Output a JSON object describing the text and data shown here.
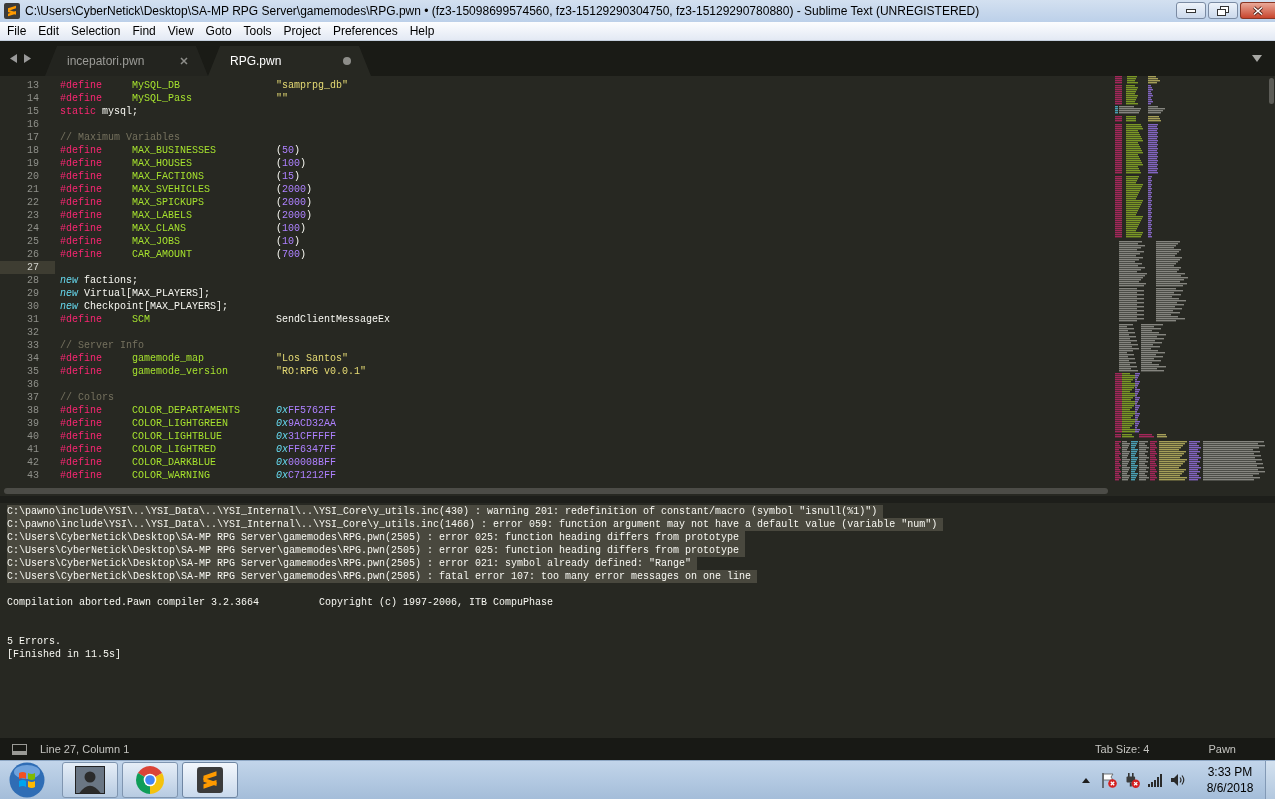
{
  "window": {
    "title": "C:\\Users\\CyberNetick\\Desktop\\SA-MP RPG Server\\gamemodes\\RPG.pwn • (fz3-15098699574560, fz3-15129290304750, fz3-15129290780880) - Sublime Text (UNREGISTERED)"
  },
  "menu": [
    "File",
    "Edit",
    "Selection",
    "Find",
    "View",
    "Goto",
    "Tools",
    "Project",
    "Preferences",
    "Help"
  ],
  "tabs": [
    {
      "label": "incepatori.pwn",
      "selected": false,
      "modified": false
    },
    {
      "label": "RPG.pwn",
      "selected": true,
      "modified": true
    }
  ],
  "editor": {
    "lines": [
      {
        "number": "13",
        "current": false,
        "kind": "define",
        "keyword": "#define",
        "name": "MySQL_DB",
        "value": [
          {
            "kind": "string",
            "text": "\"samprpg_db\""
          }
        ]
      },
      {
        "number": "14",
        "current": false,
        "kind": "define",
        "keyword": "#define",
        "name": "MySQL_Pass",
        "value": [
          {
            "kind": "string",
            "text": "\"\""
          }
        ]
      },
      {
        "number": "15",
        "current": false,
        "kind": "statement",
        "words": [
          {
            "kind": "keyword",
            "text": "static"
          },
          {
            "kind": "plain",
            "text": "mysql;"
          }
        ]
      },
      {
        "number": "16",
        "current": false,
        "kind": "blank"
      },
      {
        "number": "17",
        "current": false,
        "kind": "comment",
        "text": "// Maximum Variables"
      },
      {
        "number": "18",
        "current": false,
        "kind": "define",
        "keyword": "#define",
        "name": "MAX_BUSINESSES",
        "value": [
          {
            "kind": "plain",
            "text": "("
          },
          {
            "kind": "number",
            "text": "50"
          },
          {
            "kind": "plain",
            "text": ")"
          }
        ]
      },
      {
        "number": "19",
        "current": false,
        "kind": "define",
        "keyword": "#define",
        "name": "MAX_HOUSES",
        "value": [
          {
            "kind": "plain",
            "text": "("
          },
          {
            "kind": "number",
            "text": "100"
          },
          {
            "kind": "plain",
            "text": ")"
          }
        ]
      },
      {
        "number": "20",
        "current": false,
        "kind": "define",
        "keyword": "#define",
        "name": "MAX_FACTIONS",
        "value": [
          {
            "kind": "plain",
            "text": "("
          },
          {
            "kind": "number",
            "text": "15"
          },
          {
            "kind": "plain",
            "text": ")"
          }
        ]
      },
      {
        "number": "21",
        "current": false,
        "kind": "define",
        "keyword": "#define",
        "name": "MAX_SVEHICLES",
        "value": [
          {
            "kind": "plain",
            "text": "("
          },
          {
            "kind": "number",
            "text": "2000"
          },
          {
            "kind": "plain",
            "text": ")"
          }
        ]
      },
      {
        "number": "22",
        "current": false,
        "kind": "define",
        "keyword": "#define",
        "name": "MAX_SPICKUPS",
        "value": [
          {
            "kind": "plain",
            "text": "("
          },
          {
            "kind": "number",
            "text": "2000"
          },
          {
            "kind": "plain",
            "text": ")"
          }
        ]
      },
      {
        "number": "23",
        "current": false,
        "kind": "define",
        "keyword": "#define",
        "name": "MAX_LABELS",
        "value": [
          {
            "kind": "plain",
            "text": "("
          },
          {
            "kind": "number",
            "text": "2000"
          },
          {
            "kind": "plain",
            "text": ")"
          }
        ]
      },
      {
        "number": "24",
        "current": false,
        "kind": "define",
        "keyword": "#define",
        "name": "MAX_CLANS",
        "value": [
          {
            "kind": "plain",
            "text": "("
          },
          {
            "kind": "number",
            "text": "100"
          },
          {
            "kind": "plain",
            "text": ")"
          }
        ]
      },
      {
        "number": "25",
        "current": false,
        "kind": "define",
        "keyword": "#define",
        "name": "MAX_JOBS",
        "value": [
          {
            "kind": "plain",
            "text": "("
          },
          {
            "kind": "number",
            "text": "10"
          },
          {
            "kind": "plain",
            "text": ")"
          }
        ]
      },
      {
        "number": "26",
        "current": false,
        "kind": "define",
        "keyword": "#define",
        "name": "CAR_AMOUNT",
        "value": [
          {
            "kind": "plain",
            "text": "("
          },
          {
            "kind": "number",
            "text": "700"
          },
          {
            "kind": "plain",
            "text": ")"
          }
        ]
      },
      {
        "number": "27",
        "current": true,
        "kind": "blank"
      },
      {
        "number": "28",
        "current": false,
        "kind": "statement",
        "words": [
          {
            "kind": "storage",
            "text": "new"
          },
          {
            "kind": "plain",
            "text": "factions;"
          }
        ]
      },
      {
        "number": "29",
        "current": false,
        "kind": "statement",
        "words": [
          {
            "kind": "storage",
            "text": "new"
          },
          {
            "kind": "plain",
            "text": "Virtual[MAX_PLAYERS];"
          }
        ]
      },
      {
        "number": "30",
        "current": false,
        "kind": "statement",
        "words": [
          {
            "kind": "storage",
            "text": "new"
          },
          {
            "kind": "plain",
            "text": "Checkpoint[MAX_PLAYERS];"
          }
        ]
      },
      {
        "number": "31",
        "current": false,
        "kind": "define",
        "keyword": "#define",
        "name": "SCM",
        "value": [
          {
            "kind": "plain",
            "text": "SendClientMessageEx"
          }
        ]
      },
      {
        "number": "32",
        "current": false,
        "kind": "blank"
      },
      {
        "number": "33",
        "current": false,
        "kind": "comment",
        "text": "// Server Info"
      },
      {
        "number": "34",
        "current": false,
        "kind": "define",
        "keyword": "#define",
        "name": "gamemode_map",
        "value": [
          {
            "kind": "string",
            "text": "\"Los Santos\""
          }
        ]
      },
      {
        "number": "35",
        "current": false,
        "kind": "define",
        "keyword": "#define",
        "name": "gamemode_version",
        "value": [
          {
            "kind": "string",
            "text": "\"RO:RPG v0.0.1\""
          }
        ]
      },
      {
        "number": "36",
        "current": false,
        "kind": "blank"
      },
      {
        "number": "37",
        "current": false,
        "kind": "comment",
        "text": "// Colors"
      },
      {
        "number": "38",
        "current": false,
        "kind": "define",
        "keyword": "#define",
        "name": "COLOR_DEPARTAMENTS",
        "value": [
          {
            "kind": "hex-prefix",
            "text": "0x"
          },
          {
            "kind": "number",
            "text": "FF5762FF"
          }
        ]
      },
      {
        "number": "39",
        "current": false,
        "kind": "define",
        "keyword": "#define",
        "name": "COLOR_LIGHTGREEN",
        "value": [
          {
            "kind": "hex-prefix",
            "text": "0x"
          },
          {
            "kind": "number",
            "text": "9ACD32AA"
          }
        ]
      },
      {
        "number": "40",
        "current": false,
        "kind": "define",
        "keyword": "#define",
        "name": "COLOR_LIGHTBLUE",
        "value": [
          {
            "kind": "hex-prefix",
            "text": "0x"
          },
          {
            "kind": "number",
            "text": "31CFFFFF"
          }
        ]
      },
      {
        "number": "41",
        "current": false,
        "kind": "define",
        "keyword": "#define",
        "name": "COLOR_LIGHTRED",
        "value": [
          {
            "kind": "hex-prefix",
            "text": "0x"
          },
          {
            "kind": "number",
            "text": "FF6347FF"
          }
        ]
      },
      {
        "number": "42",
        "current": false,
        "kind": "define",
        "keyword": "#define",
        "name": "COLOR_DARKBLUE",
        "value": [
          {
            "kind": "hex-prefix",
            "text": "0x"
          },
          {
            "kind": "number",
            "text": "00008BFF"
          }
        ]
      },
      {
        "number": "43",
        "current": false,
        "kind": "define",
        "keyword": "#define",
        "name": "COLOR_WARNING",
        "value": [
          {
            "kind": "hex-prefix",
            "text": "0x"
          },
          {
            "kind": "number",
            "text": "C71212FF"
          }
        ]
      }
    ]
  },
  "output_panel": {
    "messages": [
      {
        "text": "C:\\pawno\\include\\YSI\\..\\YSI_Data\\..\\YSI_Internal\\..\\YSI_Core\\y_utils.inc(430) : warning 201: redefinition of constant/macro (symbol \"isnull(%1)\")",
        "selected": true
      },
      {
        "text": "C:\\pawno\\include\\YSI\\..\\YSI_Data\\..\\YSI_Internal\\..\\YSI_Core\\y_utils.inc(1466) : error 059: function argument may not have a default value (variable \"num\")",
        "selected": true
      },
      {
        "text": "C:\\Users\\CyberNetick\\Desktop\\SA-MP RPG Server\\gamemodes\\RPG.pwn(2505) : error 025: function heading differs from prototype",
        "selected": true
      },
      {
        "text": "C:\\Users\\CyberNetick\\Desktop\\SA-MP RPG Server\\gamemodes\\RPG.pwn(2505) : error 025: function heading differs from prototype",
        "selected": true
      },
      {
        "text": "C:\\Users\\CyberNetick\\Desktop\\SA-MP RPG Server\\gamemodes\\RPG.pwn(2505) : error 021: symbol already defined: \"Range\"",
        "selected": true
      },
      {
        "text": "C:\\Users\\CyberNetick\\Desktop\\SA-MP RPG Server\\gamemodes\\RPG.pwn(2505) : fatal error 107: too many error messages on one line",
        "selected": true
      }
    ],
    "compiler_line": {
      "status": "Compilation aborted.Pawn compiler 3.2.3664",
      "copyright": "Copyright (c) 1997-2006, ITB CompuPhase"
    },
    "summary": [
      "5 Errors.",
      "[Finished in 11.5s]"
    ]
  },
  "status_bar": {
    "position": "Line 27, Column 1",
    "tab_size": "Tab Size: 4",
    "syntax": "Pawn"
  },
  "taskbar": {
    "time": "3:33 PM",
    "date": "8/6/2018"
  }
}
